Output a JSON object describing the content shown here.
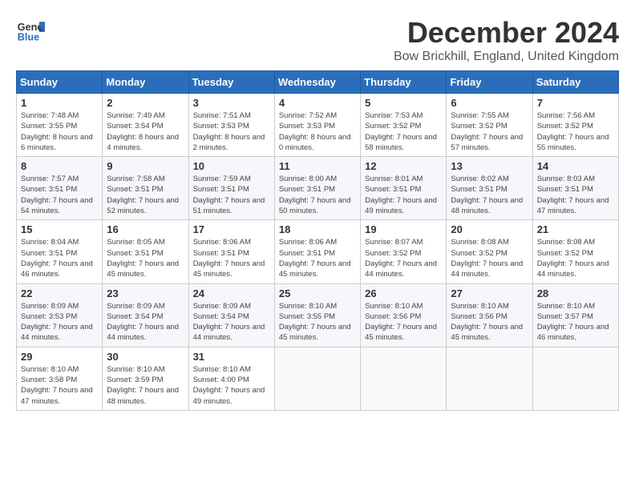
{
  "logo": {
    "line1": "General",
    "line2": "Blue"
  },
  "title": "December 2024",
  "location": "Bow Brickhill, England, United Kingdom",
  "days_header": [
    "Sunday",
    "Monday",
    "Tuesday",
    "Wednesday",
    "Thursday",
    "Friday",
    "Saturday"
  ],
  "weeks": [
    [
      {
        "day": "1",
        "sunrise": "7:48 AM",
        "sunset": "3:55 PM",
        "daylight": "8 hours and 6 minutes."
      },
      {
        "day": "2",
        "sunrise": "7:49 AM",
        "sunset": "3:54 PM",
        "daylight": "8 hours and 4 minutes."
      },
      {
        "day": "3",
        "sunrise": "7:51 AM",
        "sunset": "3:53 PM",
        "daylight": "8 hours and 2 minutes."
      },
      {
        "day": "4",
        "sunrise": "7:52 AM",
        "sunset": "3:53 PM",
        "daylight": "8 hours and 0 minutes."
      },
      {
        "day": "5",
        "sunrise": "7:53 AM",
        "sunset": "3:52 PM",
        "daylight": "7 hours and 58 minutes."
      },
      {
        "day": "6",
        "sunrise": "7:55 AM",
        "sunset": "3:52 PM",
        "daylight": "7 hours and 57 minutes."
      },
      {
        "day": "7",
        "sunrise": "7:56 AM",
        "sunset": "3:52 PM",
        "daylight": "7 hours and 55 minutes."
      }
    ],
    [
      {
        "day": "8",
        "sunrise": "7:57 AM",
        "sunset": "3:51 PM",
        "daylight": "7 hours and 54 minutes."
      },
      {
        "day": "9",
        "sunrise": "7:58 AM",
        "sunset": "3:51 PM",
        "daylight": "7 hours and 52 minutes."
      },
      {
        "day": "10",
        "sunrise": "7:59 AM",
        "sunset": "3:51 PM",
        "daylight": "7 hours and 51 minutes."
      },
      {
        "day": "11",
        "sunrise": "8:00 AM",
        "sunset": "3:51 PM",
        "daylight": "7 hours and 50 minutes."
      },
      {
        "day": "12",
        "sunrise": "8:01 AM",
        "sunset": "3:51 PM",
        "daylight": "7 hours and 49 minutes."
      },
      {
        "day": "13",
        "sunrise": "8:02 AM",
        "sunset": "3:51 PM",
        "daylight": "7 hours and 48 minutes."
      },
      {
        "day": "14",
        "sunrise": "8:03 AM",
        "sunset": "3:51 PM",
        "daylight": "7 hours and 47 minutes."
      }
    ],
    [
      {
        "day": "15",
        "sunrise": "8:04 AM",
        "sunset": "3:51 PM",
        "daylight": "7 hours and 46 minutes."
      },
      {
        "day": "16",
        "sunrise": "8:05 AM",
        "sunset": "3:51 PM",
        "daylight": "7 hours and 45 minutes."
      },
      {
        "day": "17",
        "sunrise": "8:06 AM",
        "sunset": "3:51 PM",
        "daylight": "7 hours and 45 minutes."
      },
      {
        "day": "18",
        "sunrise": "8:06 AM",
        "sunset": "3:51 PM",
        "daylight": "7 hours and 45 minutes."
      },
      {
        "day": "19",
        "sunrise": "8:07 AM",
        "sunset": "3:52 PM",
        "daylight": "7 hours and 44 minutes."
      },
      {
        "day": "20",
        "sunrise": "8:08 AM",
        "sunset": "3:52 PM",
        "daylight": "7 hours and 44 minutes."
      },
      {
        "day": "21",
        "sunrise": "8:08 AM",
        "sunset": "3:52 PM",
        "daylight": "7 hours and 44 minutes."
      }
    ],
    [
      {
        "day": "22",
        "sunrise": "8:09 AM",
        "sunset": "3:53 PM",
        "daylight": "7 hours and 44 minutes."
      },
      {
        "day": "23",
        "sunrise": "8:09 AM",
        "sunset": "3:54 PM",
        "daylight": "7 hours and 44 minutes."
      },
      {
        "day": "24",
        "sunrise": "8:09 AM",
        "sunset": "3:54 PM",
        "daylight": "7 hours and 44 minutes."
      },
      {
        "day": "25",
        "sunrise": "8:10 AM",
        "sunset": "3:55 PM",
        "daylight": "7 hours and 45 minutes."
      },
      {
        "day": "26",
        "sunrise": "8:10 AM",
        "sunset": "3:56 PM",
        "daylight": "7 hours and 45 minutes."
      },
      {
        "day": "27",
        "sunrise": "8:10 AM",
        "sunset": "3:56 PM",
        "daylight": "7 hours and 45 minutes."
      },
      {
        "day": "28",
        "sunrise": "8:10 AM",
        "sunset": "3:57 PM",
        "daylight": "7 hours and 46 minutes."
      }
    ],
    [
      {
        "day": "29",
        "sunrise": "8:10 AM",
        "sunset": "3:58 PM",
        "daylight": "7 hours and 47 minutes."
      },
      {
        "day": "30",
        "sunrise": "8:10 AM",
        "sunset": "3:59 PM",
        "daylight": "7 hours and 48 minutes."
      },
      {
        "day": "31",
        "sunrise": "8:10 AM",
        "sunset": "4:00 PM",
        "daylight": "7 hours and 49 minutes."
      },
      null,
      null,
      null,
      null
    ]
  ]
}
